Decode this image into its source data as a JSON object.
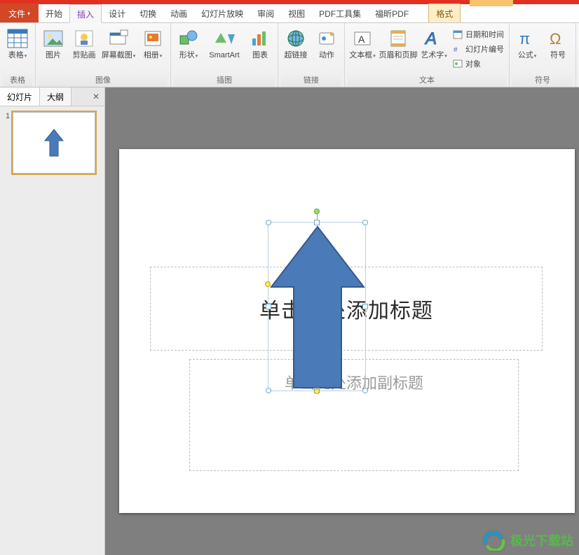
{
  "tabs": {
    "file": "文件",
    "items": [
      "开始",
      "插入",
      "设计",
      "切换",
      "动画",
      "幻灯片放映",
      "审阅",
      "视图",
      "PDF工具集",
      "福昕PDF"
    ],
    "activeIndex": 1,
    "format": "格式"
  },
  "ribbon": {
    "groups": {
      "tables": {
        "label": "表格",
        "table": "表格"
      },
      "images": {
        "label": "图像",
        "picture": "图片",
        "clipart": "剪贴画",
        "screenshot": "屏幕截图",
        "album": "相册"
      },
      "illus": {
        "label": "插图",
        "shapes": "形状",
        "smartart": "SmartArt",
        "chart": "图表"
      },
      "links": {
        "label": "链接",
        "hyperlink": "超链接",
        "action": "动作"
      },
      "text": {
        "label": "文本",
        "textbox": "文本框",
        "headerfooter": "页眉和页脚",
        "wordart": "艺术字",
        "datetime": "日期和时间",
        "slidenum": "幻灯片编号",
        "object": "对象"
      },
      "symbols": {
        "label": "符号",
        "equation": "公式",
        "symbol": "符号"
      }
    }
  },
  "leftpane": {
    "tab_slides": "幻灯片",
    "tab_outline": "大纲",
    "slide_number": "1"
  },
  "slide": {
    "title_placeholder": "单击此处添加标题",
    "subtitle_placeholder": "单击此处添加副标题"
  },
  "watermark": "极光下载站"
}
